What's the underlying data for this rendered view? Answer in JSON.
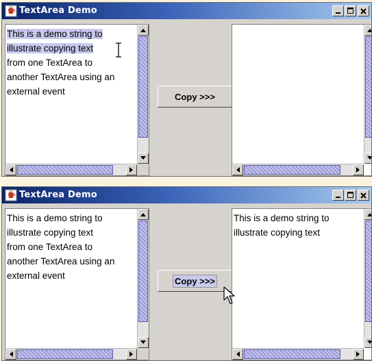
{
  "windows": [
    {
      "title": "TextArea Demo",
      "left_text": {
        "lines": [
          {
            "text": "This is a demo string to",
            "selected": true
          },
          {
            "text": "illustrate copying text",
            "selected": true
          },
          {
            "text": "from one TextArea to",
            "selected": false
          },
          {
            "text": "another TextArea using an",
            "selected": false
          },
          {
            "text": "external event",
            "selected": false
          }
        ]
      },
      "copy_label": "Copy >>>",
      "right_text": {
        "lines": []
      },
      "copy_focused": false
    },
    {
      "title": "TextArea Demo",
      "left_text": {
        "lines": [
          {
            "text": "This is a demo string to",
            "selected": false
          },
          {
            "text": "illustrate copying text",
            "selected": false
          },
          {
            "text": "from one TextArea to",
            "selected": false
          },
          {
            "text": "another TextArea using an",
            "selected": false
          },
          {
            "text": "external event",
            "selected": false
          }
        ]
      },
      "copy_label": "Copy >>>",
      "right_text": {
        "lines": [
          {
            "text": "This is a demo string to",
            "selected": false
          },
          {
            "text": "illustrate copying text",
            "selected": false
          }
        ]
      },
      "copy_focused": true
    }
  ],
  "icons": {
    "app": "java-cup-icon",
    "minimize": "minimize-icon",
    "maximize": "maximize-icon",
    "close": "close-icon",
    "scroll_up": "arrow-up-icon",
    "scroll_down": "arrow-down-icon",
    "scroll_left": "arrow-left-icon",
    "scroll_right": "arrow-right-icon"
  },
  "colors": {
    "titlebar_start": "#0a246a",
    "titlebar_end": "#a6caf0",
    "selection": "#c8c8ee",
    "scroll_thumb": "#9a9ad8",
    "window_bg": "#d6d3ce"
  }
}
